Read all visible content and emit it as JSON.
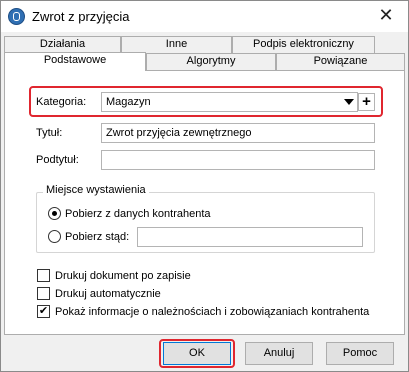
{
  "window": {
    "title": "Zwrot z przyjęcia",
    "close_glyph": "✕",
    "icon": "app-logo-icon"
  },
  "tabs_row1": [
    {
      "label": "Działania"
    },
    {
      "label": "Inne"
    },
    {
      "label": "Podpis elektroniczny"
    }
  ],
  "tabs_row2": [
    {
      "label": "Podstawowe",
      "active": true
    },
    {
      "label": "Algorytmy"
    },
    {
      "label": "Powiązane"
    }
  ],
  "form": {
    "kategoria_label": "Kategoria:",
    "kategoria_value": "Magazyn",
    "add_glyph": "+",
    "tytul_label": "Tytuł:",
    "tytul_value": "Zwrot przyjęcia zewnętrznego",
    "podtytul_label": "Podtytuł:",
    "podtytul_value": ""
  },
  "miejsce": {
    "legend": "Miejsce wystawienia",
    "option1": "Pobierz z danych kontrahenta",
    "option1_selected": true,
    "option2": "Pobierz stąd:",
    "option2_value": ""
  },
  "checks": [
    {
      "label": "Drukuj dokument po zapisie",
      "checked": false
    },
    {
      "label": "Drukuj automatycznie",
      "checked": false
    },
    {
      "label": "Pokaż informacje o należnościach i zobowiązaniach kontrahenta",
      "checked": true
    }
  ],
  "check_mark": "✔",
  "buttons": {
    "ok": "OK",
    "cancel": "Anuluj",
    "help": "Pomoc"
  },
  "colors": {
    "highlight": "#e0262f",
    "accent": "#0078d7"
  }
}
